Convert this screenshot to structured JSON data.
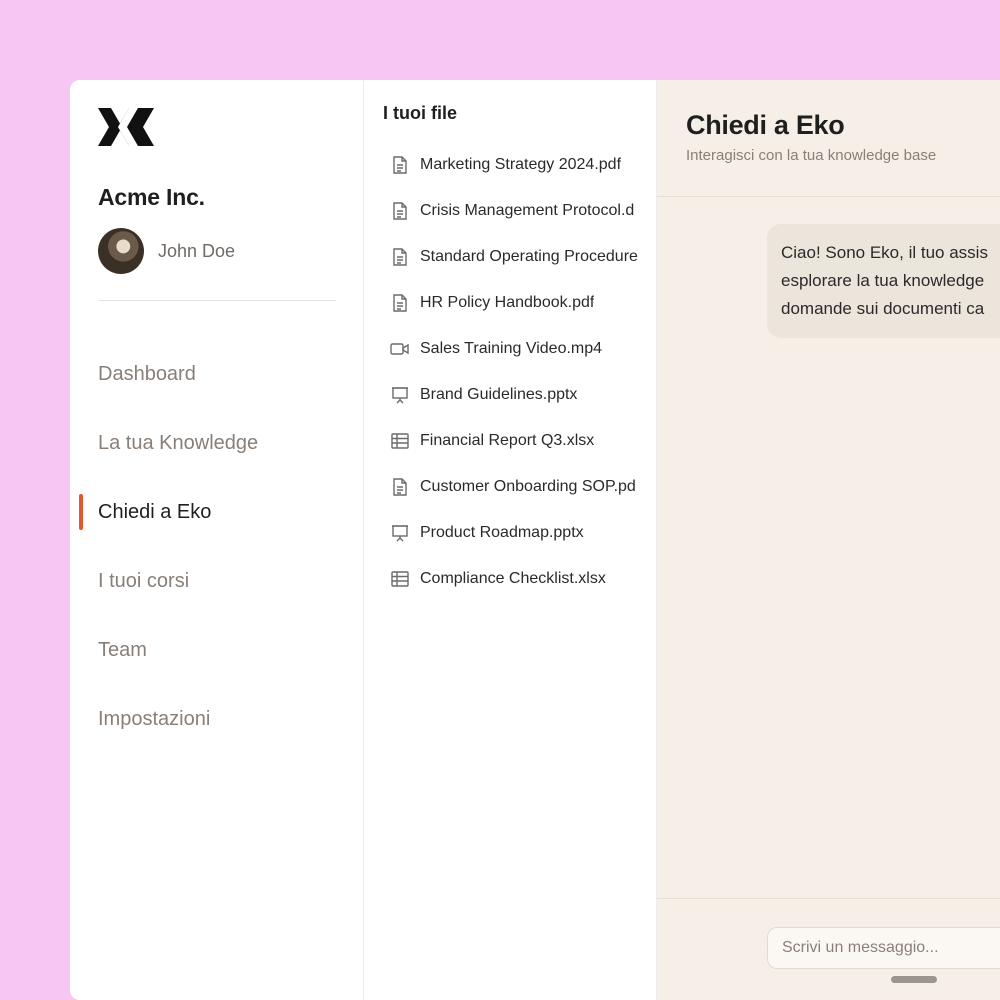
{
  "sidebar": {
    "logo_icon": "x-logo-icon",
    "company": "Acme Inc.",
    "user_name": "John Doe",
    "nav": [
      {
        "label": "Dashboard",
        "active": false
      },
      {
        "label": "La tua Knowledge",
        "active": false
      },
      {
        "label": "Chiedi a Eko",
        "active": true
      },
      {
        "label": "I tuoi corsi",
        "active": false
      },
      {
        "label": "Team",
        "active": false
      },
      {
        "label": "Impostazioni",
        "active": false
      }
    ],
    "accent_color": "#e2582b"
  },
  "files": {
    "title": "I tuoi file",
    "items": [
      {
        "name": "Marketing Strategy 2024.pdf",
        "icon": "document-icon"
      },
      {
        "name": "Crisis Management Protocol.d",
        "icon": "document-icon"
      },
      {
        "name": "Standard Operating Procedure",
        "icon": "document-icon"
      },
      {
        "name": "HR Policy Handbook.pdf",
        "icon": "document-icon"
      },
      {
        "name": "Sales Training Video.mp4",
        "icon": "video-icon"
      },
      {
        "name": "Brand Guidelines.pptx",
        "icon": "presentation-icon"
      },
      {
        "name": "Financial Report Q3.xlsx",
        "icon": "spreadsheet-icon"
      },
      {
        "name": "Customer Onboarding SOP.pd",
        "icon": "document-icon"
      },
      {
        "name": "Product Roadmap.pptx",
        "icon": "presentation-icon"
      },
      {
        "name": "Compliance Checklist.xlsx",
        "icon": "spreadsheet-icon"
      }
    ]
  },
  "chat": {
    "title": "Chiedi a Eko",
    "subtitle": "Interagisci con la tua knowledge base",
    "messages": [
      {
        "role": "assistant",
        "lines": [
          "Ciao! Sono Eko, il tuo assis",
          "esplorare la tua knowledge",
          "domande sui documenti ca"
        ]
      }
    ],
    "input_placeholder": "Scrivi un messaggio..."
  }
}
